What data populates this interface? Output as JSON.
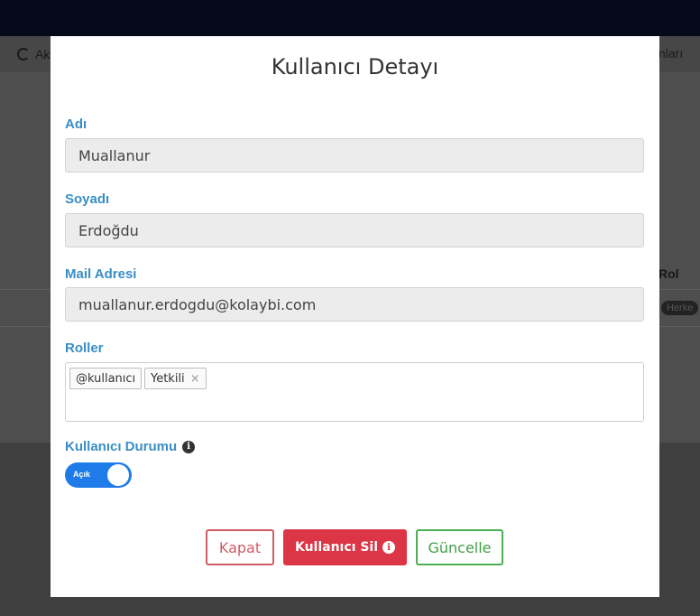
{
  "background": {
    "subbar_left": "Ak",
    "subbar_right": "nları",
    "column_header": "Rol",
    "badge": "Herke"
  },
  "modal": {
    "title": "Kullanıcı Detayı",
    "fields": {
      "first_name": {
        "label": "Adı",
        "value": "Muallanur"
      },
      "last_name": {
        "label": "Soyadı",
        "value": "Erdoğdu"
      },
      "email": {
        "label": "Mail Adresi",
        "value": "muallanur.erdogdu@kolaybi.com"
      }
    },
    "roles": {
      "label": "Roller",
      "tags": [
        "@kullanıcı",
        "Yetkili"
      ],
      "remove_symbol": "×"
    },
    "status": {
      "label": "Kullanıcı Durumu",
      "toggle_text": "Açık",
      "enabled": true
    },
    "buttons": {
      "close": "Kapat",
      "delete": "Kullanıcı Sil",
      "update": "Güncelle"
    },
    "colors": {
      "label": "#3a8ec4",
      "toggle": "#1f7be8",
      "danger": "#dc3545",
      "success": "#4caf50"
    }
  }
}
